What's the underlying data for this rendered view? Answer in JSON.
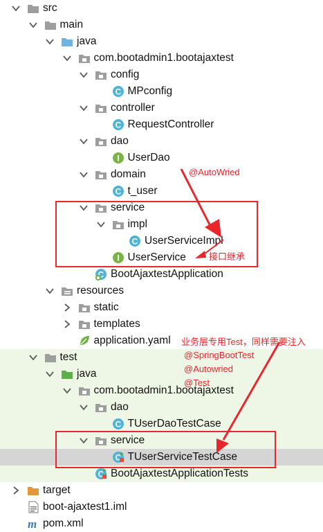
{
  "tree": [
    {
      "label": "src",
      "level": 0,
      "arrow": "down",
      "icon": "folder-icon"
    },
    {
      "label": "main",
      "level": 1,
      "arrow": "down",
      "icon": "folder-icon"
    },
    {
      "label": "java",
      "level": 2,
      "arrow": "down",
      "icon": "source-folder-icon"
    },
    {
      "label": "com.bootadmin1.bootajaxtest",
      "level": 3,
      "arrow": "down",
      "icon": "package-icon"
    },
    {
      "label": "config",
      "level": 4,
      "arrow": "down",
      "icon": "package-icon"
    },
    {
      "label": "MPconfig",
      "level": 5,
      "arrow": "none",
      "icon": "class-icon"
    },
    {
      "label": "controller",
      "level": 4,
      "arrow": "down",
      "icon": "package-icon"
    },
    {
      "label": "RequestController",
      "level": 5,
      "arrow": "none",
      "icon": "class-icon"
    },
    {
      "label": "dao",
      "level": 4,
      "arrow": "down",
      "icon": "package-icon"
    },
    {
      "label": "UserDao",
      "level": 5,
      "arrow": "none",
      "icon": "interface-icon"
    },
    {
      "label": "domain",
      "level": 4,
      "arrow": "down",
      "icon": "package-icon"
    },
    {
      "label": "t_user",
      "level": 5,
      "arrow": "none",
      "icon": "class-icon"
    },
    {
      "label": "service",
      "level": 4,
      "arrow": "down",
      "icon": "package-icon"
    },
    {
      "label": "impl",
      "level": 5,
      "arrow": "down",
      "icon": "package-icon"
    },
    {
      "label": "UserServiceImpl",
      "level": 6,
      "arrow": "none",
      "icon": "class-icon"
    },
    {
      "label": "UserService",
      "level": 5,
      "arrow": "none",
      "icon": "interface-icon"
    },
    {
      "label": "BootAjaxtestApplication",
      "level": 4,
      "arrow": "none",
      "icon": "spring-boot-class-icon"
    },
    {
      "label": "resources",
      "level": 2,
      "arrow": "down",
      "icon": "resources-folder-icon"
    },
    {
      "label": "static",
      "level": 3,
      "arrow": "right",
      "icon": "package-icon"
    },
    {
      "label": "templates",
      "level": 3,
      "arrow": "right",
      "icon": "package-icon"
    },
    {
      "label": "application.yaml",
      "level": 3,
      "arrow": "none",
      "icon": "yaml-leaf-icon"
    },
    {
      "label": "test",
      "level": 1,
      "arrow": "down",
      "icon": "folder-icon"
    },
    {
      "label": "java",
      "level": 2,
      "arrow": "down",
      "icon": "test-source-folder-icon"
    },
    {
      "label": "com.bootadmin1.bootajaxtest",
      "level": 3,
      "arrow": "down",
      "icon": "package-icon"
    },
    {
      "label": "dao",
      "level": 4,
      "arrow": "down",
      "icon": "package-icon"
    },
    {
      "label": "TUserDaoTestCase",
      "level": 5,
      "arrow": "none",
      "icon": "class-icon"
    },
    {
      "label": "service",
      "level": 4,
      "arrow": "down",
      "icon": "package-icon"
    },
    {
      "label": "TUserServiceTestCase",
      "level": 5,
      "arrow": "none",
      "icon": "test-class-icon",
      "selected": true
    },
    {
      "label": "BootAjaxtestApplicationTests",
      "level": 4,
      "arrow": "none",
      "icon": "test-class-icon"
    },
    {
      "label": "target",
      "level": 0,
      "arrow": "right",
      "icon": "excluded-folder-icon"
    },
    {
      "label": "boot-ajaxtest1.iml",
      "level": 0,
      "arrow": "none",
      "icon": "iml-file-icon"
    },
    {
      "label": "pom.xml",
      "level": 0,
      "arrow": "none",
      "icon": "maven-icon"
    }
  ],
  "annotations": {
    "autowried_label": "@AutoWried",
    "interface_inherit_label": "接口继承",
    "test_note_line1": "业务层专用Test，同样需要注入",
    "test_note_line2": "@SpringBootTest",
    "test_note_line3": "@Autowried",
    "test_note_line4": "@Test"
  },
  "colors": {
    "annotation_red": "#e8262c",
    "selected_row": "#d5d5d5",
    "test_area_bg": "#eef7e6",
    "class_icon": "#4fb4d8",
    "interface_icon": "#7cb342",
    "folder_grey": "#9e9e9e",
    "source_folder_blue": "#6fb3e3",
    "test_folder_green": "#5fae4a",
    "target_orange": "#e4963a"
  }
}
